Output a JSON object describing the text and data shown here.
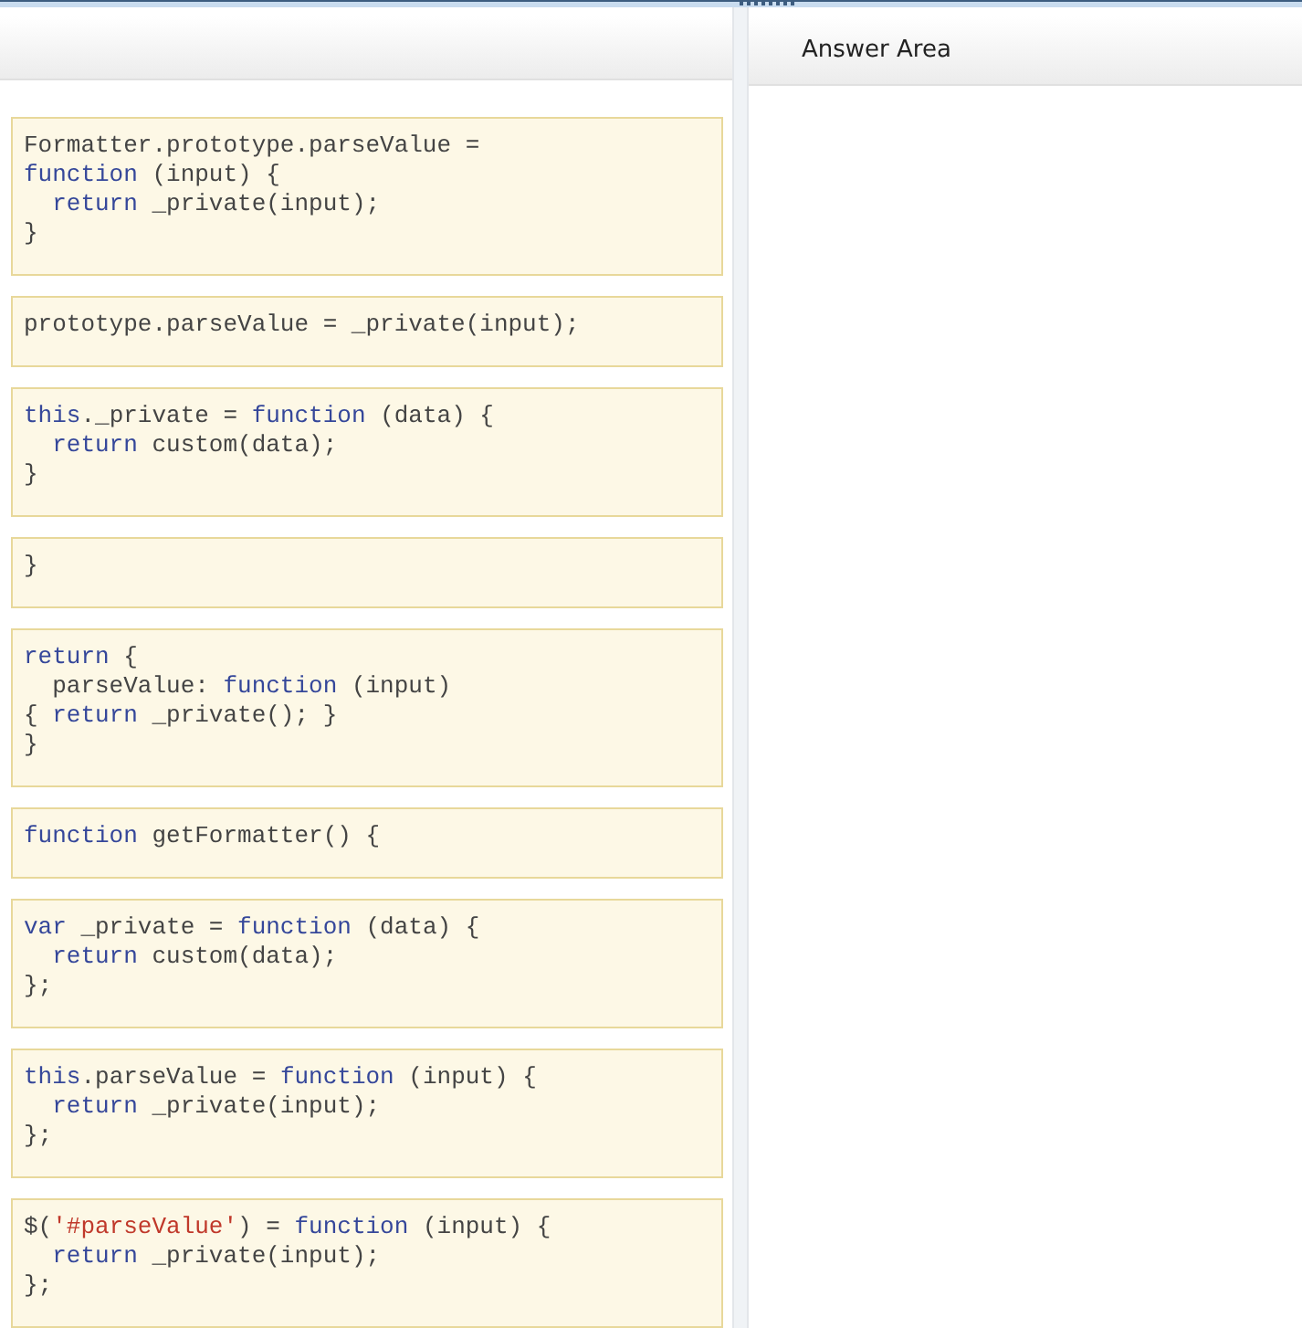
{
  "answer_area": {
    "title": "Answer Area"
  },
  "tiles": [
    {
      "lines": [
        [
          {
            "kind": "plain",
            "text": "Formatter.prototype.parseValue ="
          }
        ],
        [
          {
            "kind": "keyword",
            "text": "function"
          },
          {
            "kind": "plain",
            "text": " (input) {"
          }
        ],
        [
          {
            "kind": "keyword",
            "text": "  return"
          },
          {
            "kind": "plain",
            "text": " _private(input);"
          }
        ],
        [
          {
            "kind": "plain",
            "text": "}"
          }
        ]
      ]
    },
    {
      "lines": [
        [
          {
            "kind": "plain",
            "text": "prototype.parseValue = _private(input);"
          }
        ]
      ]
    },
    {
      "lines": [
        [
          {
            "kind": "keyword",
            "text": "this"
          },
          {
            "kind": "plain",
            "text": "._private = "
          },
          {
            "kind": "keyword",
            "text": "function"
          },
          {
            "kind": "plain",
            "text": " (data) {"
          }
        ],
        [
          {
            "kind": "keyword",
            "text": "  return"
          },
          {
            "kind": "plain",
            "text": " custom(data);"
          }
        ],
        [
          {
            "kind": "plain",
            "text": "}"
          }
        ]
      ]
    },
    {
      "lines": [
        [
          {
            "kind": "plain",
            "text": "}"
          }
        ]
      ]
    },
    {
      "lines": [
        [
          {
            "kind": "keyword",
            "text": "return"
          },
          {
            "kind": "plain",
            "text": " {"
          }
        ],
        [
          {
            "kind": "plain",
            "text": "  parseValue: "
          },
          {
            "kind": "keyword",
            "text": "function"
          },
          {
            "kind": "plain",
            "text": " (input)"
          }
        ],
        [
          {
            "kind": "plain",
            "text": "{ "
          },
          {
            "kind": "keyword",
            "text": "return"
          },
          {
            "kind": "plain",
            "text": " _private(); }"
          }
        ],
        [
          {
            "kind": "plain",
            "text": "}"
          }
        ]
      ]
    },
    {
      "lines": [
        [
          {
            "kind": "keyword",
            "text": "function"
          },
          {
            "kind": "plain",
            "text": " getFormatter() {"
          }
        ]
      ]
    },
    {
      "lines": [
        [
          {
            "kind": "keyword",
            "text": "var"
          },
          {
            "kind": "plain",
            "text": " _private = "
          },
          {
            "kind": "keyword",
            "text": "function"
          },
          {
            "kind": "plain",
            "text": " (data) {"
          }
        ],
        [
          {
            "kind": "keyword",
            "text": "  return"
          },
          {
            "kind": "plain",
            "text": " custom(data);"
          }
        ],
        [
          {
            "kind": "plain",
            "text": "};"
          }
        ]
      ]
    },
    {
      "lines": [
        [
          {
            "kind": "keyword",
            "text": "this"
          },
          {
            "kind": "plain",
            "text": ".parseValue = "
          },
          {
            "kind": "keyword",
            "text": "function"
          },
          {
            "kind": "plain",
            "text": " (input) {"
          }
        ],
        [
          {
            "kind": "keyword",
            "text": "  return"
          },
          {
            "kind": "plain",
            "text": " _private(input);"
          }
        ],
        [
          {
            "kind": "plain",
            "text": "};"
          }
        ]
      ]
    },
    {
      "lines": [
        [
          {
            "kind": "plain",
            "text": "$("
          },
          {
            "kind": "string",
            "text": "'#parseValue'"
          },
          {
            "kind": "plain",
            "text": ") = "
          },
          {
            "kind": "keyword",
            "text": "function"
          },
          {
            "kind": "plain",
            "text": " (input) {"
          }
        ],
        [
          {
            "kind": "keyword",
            "text": "  return"
          },
          {
            "kind": "plain",
            "text": " _private(input);"
          }
        ],
        [
          {
            "kind": "plain",
            "text": "};"
          }
        ]
      ]
    }
  ]
}
